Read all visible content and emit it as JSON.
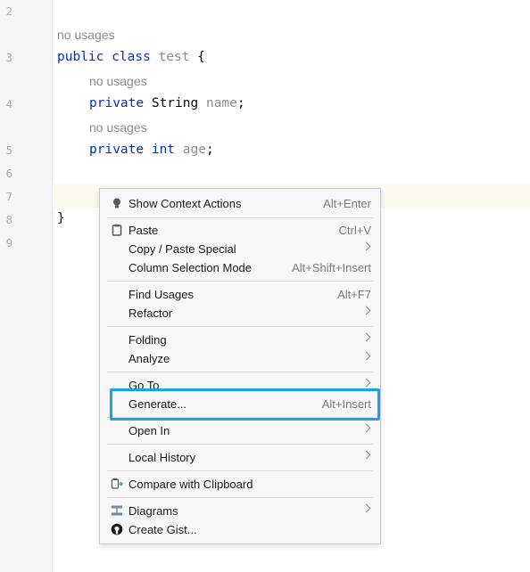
{
  "editor": {
    "line_numbers": [
      "2",
      "3",
      "4",
      "5",
      "6",
      "7",
      "8",
      "9"
    ],
    "usage_hint": "no usages",
    "line3": {
      "kw1": "public",
      "kw2": "class",
      "name": "test",
      "brace": "{"
    },
    "line4": {
      "kw": "private",
      "type": "String",
      "field": "name",
      "semi": ";"
    },
    "line5": {
      "kw": "private",
      "type": "int",
      "field": "age",
      "semi": ";"
    },
    "line8": {
      "brace": "}"
    }
  },
  "menu": {
    "show_context_actions": {
      "label": "Show Context Actions",
      "shortcut": "Alt+Enter"
    },
    "paste": {
      "label": "Paste",
      "shortcut": "Ctrl+V"
    },
    "copy_paste_special": {
      "label": "Copy / Paste Special"
    },
    "column_selection_mode": {
      "label": "Column Selection Mode",
      "shortcut": "Alt+Shift+Insert"
    },
    "find_usages": {
      "label": "Find Usages",
      "shortcut": "Alt+F7"
    },
    "refactor": {
      "label": "Refactor"
    },
    "folding": {
      "label": "Folding"
    },
    "analyze": {
      "label": "Analyze"
    },
    "go_to": {
      "label": "Go To"
    },
    "generate": {
      "label": "Generate...",
      "shortcut": "Alt+Insert"
    },
    "open_in": {
      "label": "Open In"
    },
    "local_history": {
      "label": "Local History"
    },
    "compare_clipboard": {
      "label": "Compare with Clipboard"
    },
    "diagrams": {
      "label": "Diagrams"
    },
    "create_gist": {
      "label": "Create Gist..."
    }
  },
  "colors": {
    "highlight_border": "#1aa3e8",
    "keyword": "#0033b3",
    "caret_line": "#fcfaed"
  }
}
